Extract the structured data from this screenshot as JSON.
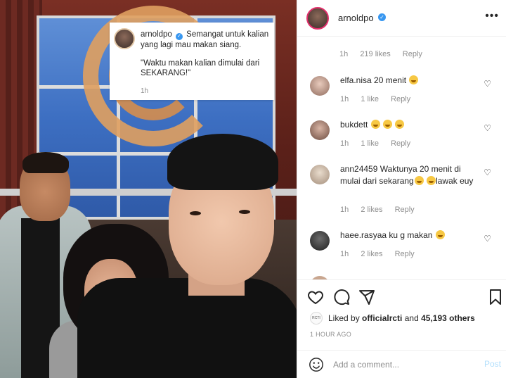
{
  "caption_card": {
    "username": "arnoldpo",
    "text": "Semangat untuk kalian yang lagi mau makan siang.",
    "quote": "\"Waktu makan kalian dimulai dari SEKARANG!\"",
    "time": "1h"
  },
  "header": {
    "username": "arnoldpo",
    "verified_icon": "verified-badge-icon",
    "more_icon": "more-options-icon"
  },
  "caption_meta": {
    "time": "1h",
    "likes": "219 likes",
    "reply": "Reply"
  },
  "comments": [
    {
      "username": "elfa.nisa",
      "text": "20 menit",
      "emoji": "😅",
      "time": "1h",
      "likes": "1 like",
      "reply": "Reply"
    },
    {
      "username": "bukdett",
      "text": "",
      "emoji": "😂 😂 😂",
      "time": "1h",
      "likes": "1 like",
      "reply": "Reply"
    },
    {
      "username": "ann24459",
      "text": "Waktunya 20 menit di mulai dari sekarang",
      "emoji": "😂 😂",
      "text2": "lawak euy",
      "time": "1h",
      "likes": "2 likes",
      "reply": "Reply"
    },
    {
      "username": "haee.rasyaa",
      "text": "ku g makan",
      "emoji": "😱",
      "time": "1h",
      "likes": "2 likes",
      "reply": "Reply"
    }
  ],
  "likes": {
    "prefix": "Liked by ",
    "user": "officialrcti",
    "suffix": " and ",
    "count": "45,193 others",
    "avatar_text": "RCTI"
  },
  "post_time": "1 HOUR AGO",
  "add_comment": {
    "placeholder": "Add a comment...",
    "post_label": "Post"
  },
  "colors": {
    "link_blue": "#3897f0",
    "post_disabled": "#b2dffc",
    "meta_gray": "#8e8e8e",
    "text": "#262626"
  }
}
